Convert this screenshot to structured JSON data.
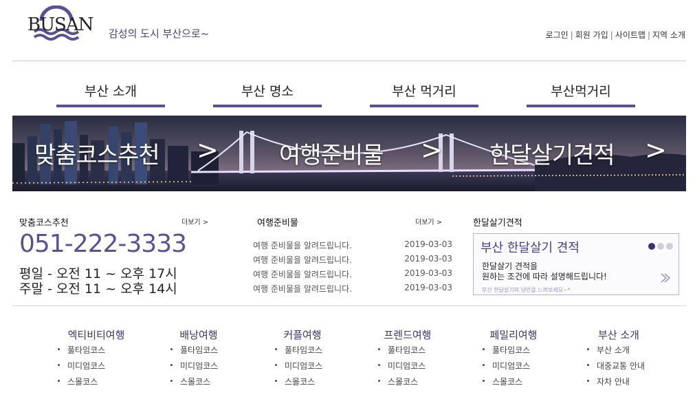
{
  "header": {
    "logo_text": "BUSAN",
    "tagline": "감성의 도시 부산으로~",
    "util_links": [
      "로그인",
      "회원 가입",
      "사이트맵",
      "지역 소개"
    ],
    "util_separator": "|"
  },
  "gnb": {
    "items": [
      "부산 소개",
      "부산 명소",
      "부산 먹거리",
      "부산먹거리"
    ]
  },
  "banner": {
    "links": [
      "맞춤코스추천",
      "여행준비물",
      "한달살기견적"
    ],
    "arrow": ">"
  },
  "course": {
    "title": "맞춤코스추천",
    "more": "더보기 >",
    "phone": "051-222-3333",
    "hours": [
      "평일 - 오전 11 ~ 오후 17시",
      "주말 - 오전 11 ~ 오후 14시"
    ]
  },
  "notice": {
    "title": "여행준비물",
    "more": "더보기 >",
    "rows": [
      {
        "title": "여행 준비물을 알려드립니다.",
        "date": "2019-03-03"
      },
      {
        "title": "여행 준비물을 알려드립니다.",
        "date": "2019-03-03"
      },
      {
        "title": "여행 준비물을 알려드립니다.",
        "date": "2019-03-03"
      },
      {
        "title": "여행 준비물을 알려드립니다.",
        "date": "2019-03-03"
      }
    ]
  },
  "promo": {
    "section_title": "한달살기견적",
    "title": "부산 한달살기 견적",
    "body_line1": "한달살기 견적을",
    "body_line2": "원하는 조건에 따라 설명해드립니다!",
    "sub": "부산 한달살기의 낭만을 느껴보세요~*",
    "slide_count": 3,
    "active_slide": 1
  },
  "footer_menu": [
    {
      "title": "엑티비티여행",
      "items": [
        "풀타임코스",
        "미디엄코스",
        "스몰코스"
      ]
    },
    {
      "title": "배낭여행",
      "items": [
        "풀타임코스",
        "미디엄코스",
        "스몰코스"
      ]
    },
    {
      "title": "커플여행",
      "items": [
        "풀타임코스",
        "미디엄코스",
        "스몰코스"
      ]
    },
    {
      "title": "프렌드여행",
      "items": [
        "풀타임코스",
        "미디엄코스",
        "스몰코스"
      ]
    },
    {
      "title": "페밀리여행",
      "items": [
        "풀타임코스",
        "미디엄코스",
        "스몰코스"
      ]
    },
    {
      "title": "부산 소개",
      "items": [
        "부산 소개",
        "대중교통 안내",
        "자차 안내"
      ]
    }
  ],
  "colors": {
    "accent": "#5d4f95",
    "accent_dark": "#3b3470",
    "rule": "#c9c9c9"
  },
  "icons": [
    "wave-logo-icon",
    "chevron-right-icon",
    "slider-dot-icon",
    "bullet-icon"
  ]
}
